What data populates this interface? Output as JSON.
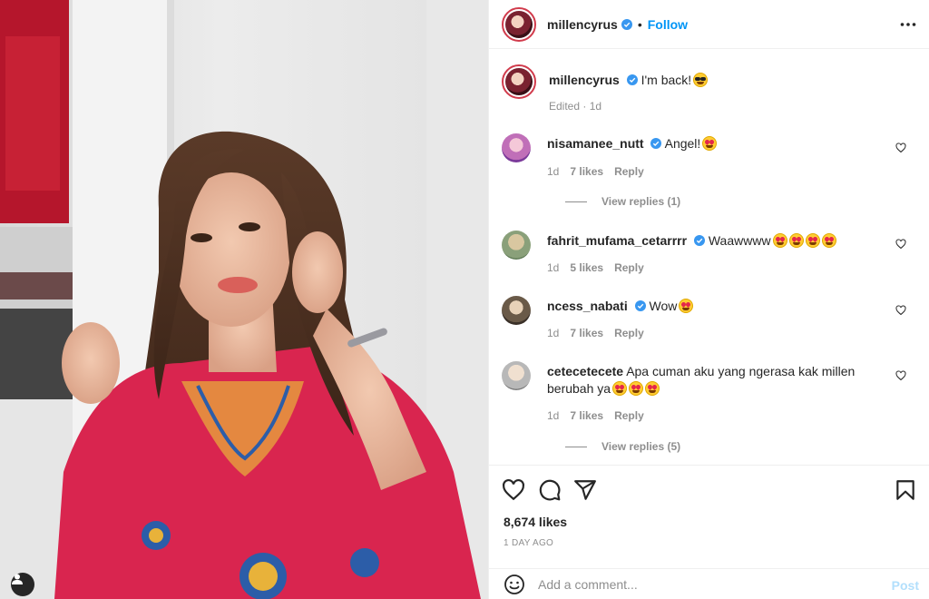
{
  "header": {
    "username": "millencyrus",
    "separator": "•",
    "follow_label": "Follow"
  },
  "caption": {
    "username": "millencyrus",
    "text": "I'm back!",
    "emoji": "sunglasses-emoji",
    "meta": "Edited · 1d"
  },
  "comments": [
    {
      "username": "nisamanee_nutt",
      "verified": true,
      "text": "Angel!",
      "emojis": 1,
      "time": "1d",
      "likes": "7 likes",
      "reply": "Reply",
      "view_replies": "View replies (1)"
    },
    {
      "username": "fahrit_mufama_cetarrrr",
      "verified": true,
      "text": "Waawwww",
      "emojis": 4,
      "time": "1d",
      "likes": "5 likes",
      "reply": "Reply"
    },
    {
      "username": "ncess_nabati",
      "verified": true,
      "text": "Wow",
      "emojis": 1,
      "time": "1d",
      "likes": "7 likes",
      "reply": "Reply"
    },
    {
      "username": "cetecetecete",
      "verified": false,
      "text": "Apa cuman aku yang ngerasa kak millen berubah ya",
      "emojis": 3,
      "time": "1d",
      "likes": "7 likes",
      "reply": "Reply",
      "view_replies": "View replies (5)"
    }
  ],
  "actions": {
    "likes": "8,674 likes",
    "date": "1 DAY AGO"
  },
  "add_comment": {
    "placeholder": "Add a comment...",
    "post_label": "Post"
  },
  "colors": {
    "accent": "#0095f6",
    "post_disabled": "#b2dffc",
    "muted": "#8e8e8e",
    "border": "#efefef",
    "dress": "#d9254f"
  },
  "icons": [
    "verified-badge-icon",
    "more-options-icon",
    "heart-icon",
    "comment-icon",
    "share-icon",
    "bookmark-icon",
    "emoji-icon",
    "tag-user-icon"
  ]
}
